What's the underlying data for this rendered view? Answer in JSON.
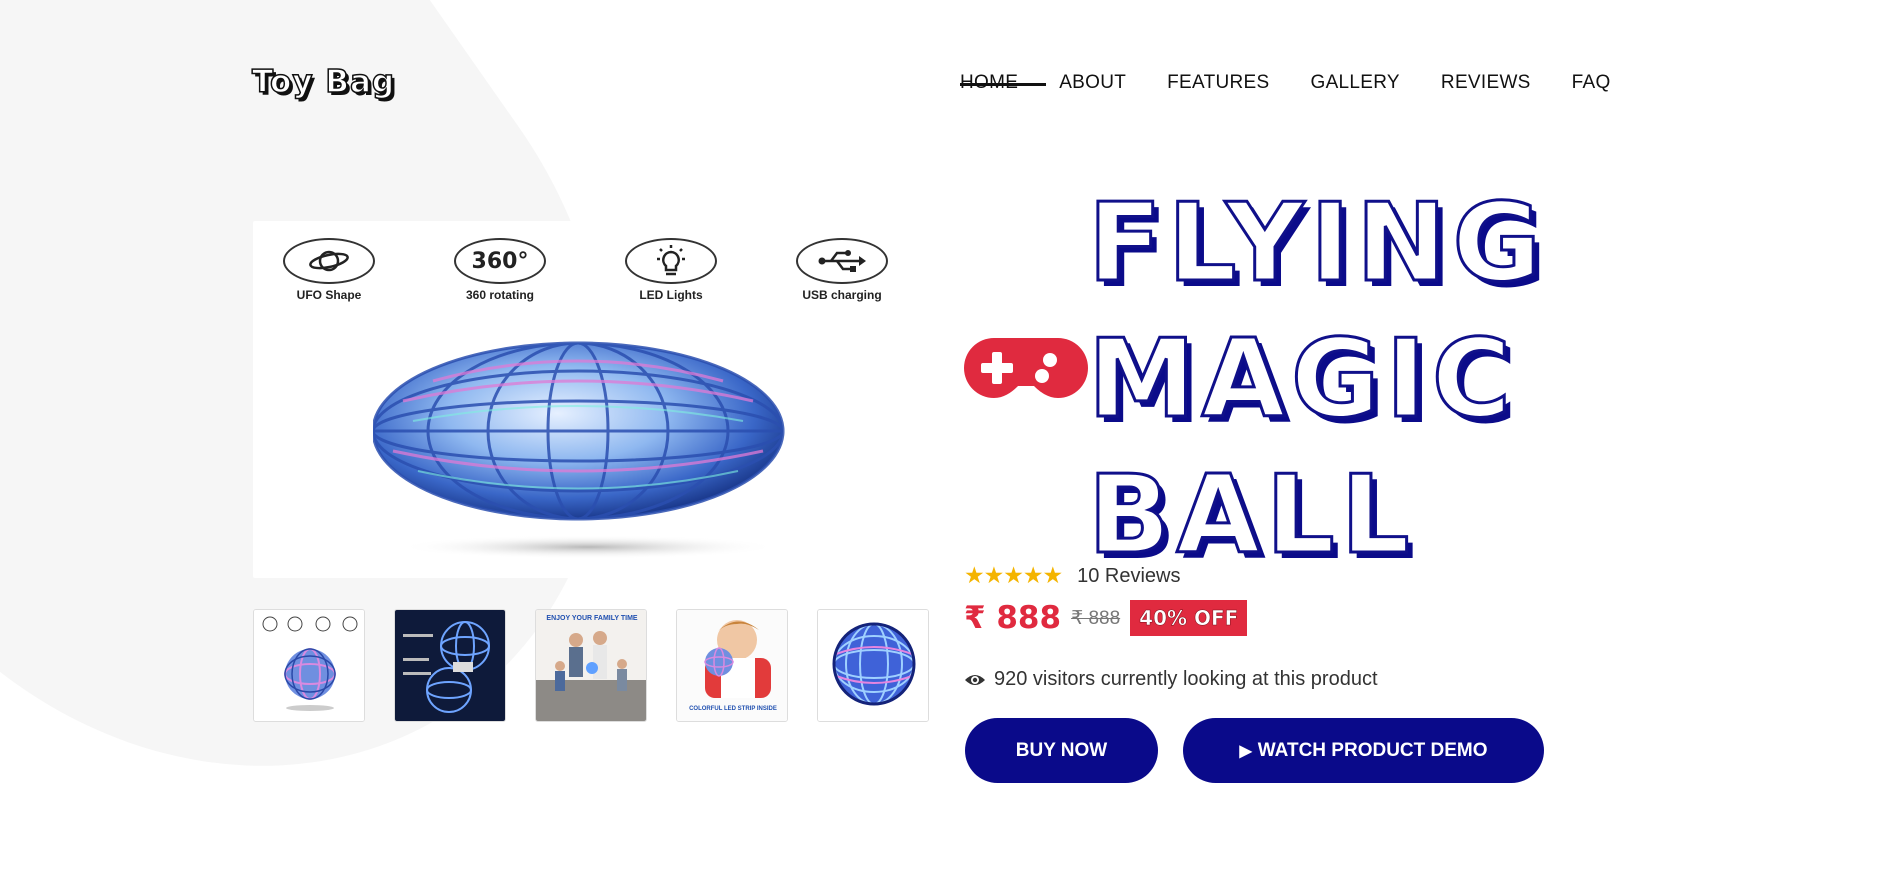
{
  "header": {
    "logo": "Toy Bag",
    "nav": [
      "HOME",
      "ABOUT",
      "FEATURES",
      "GALLERY",
      "REVIEWS",
      "FAQ"
    ],
    "active": "HOME"
  },
  "product": {
    "title_lines": [
      "FLYING",
      "MAGIC",
      "BALL"
    ],
    "features": [
      {
        "badge": "",
        "label": "UFO Shape",
        "icon": "planet-icon"
      },
      {
        "badge": "360°",
        "label": "360 rotating",
        "icon": "360-icon"
      },
      {
        "badge": "",
        "label": "LED Lights",
        "icon": "bulb-icon"
      },
      {
        "badge": "",
        "label": "USB charging",
        "icon": "usb-icon"
      }
    ],
    "rating": {
      "stars": 5,
      "reviews": "10 Reviews"
    },
    "price": "₹ 888",
    "old_price": "₹ 888",
    "discount": "40% OFF",
    "visitors": "920 visitors currently looking at this product",
    "buy_label": "BUY NOW",
    "demo_label": "WATCH PRODUCT DEMO",
    "thumb_texts": [
      "ENJOY YOUR FAMILY TIME",
      "COLORFUL LED STRIP INSIDE"
    ]
  },
  "colors": {
    "navy": "#0a0a8a",
    "red": "#e02a3f",
    "star": "#f4b400"
  }
}
